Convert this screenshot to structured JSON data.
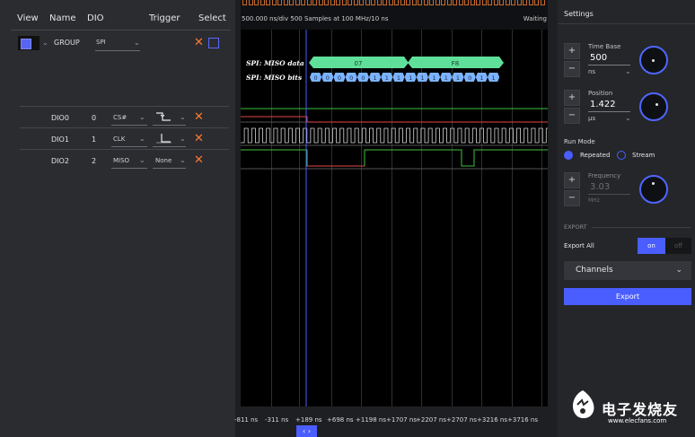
{
  "left": {
    "headers": [
      "View",
      "Name",
      "DIO",
      "Trigger",
      "Select"
    ],
    "group": {
      "name": "GROUP",
      "protocol": "SPI"
    },
    "rows": [
      {
        "name": "DIO0",
        "dio": "0",
        "signal": "CS#"
      },
      {
        "name": "DIO1",
        "dio": "1",
        "signal": "CLK"
      },
      {
        "name": "DIO2",
        "dio": "2",
        "signal": "MISO",
        "trigger_text": "None"
      }
    ],
    "close_glyph": "✕"
  },
  "scope": {
    "status_left": "500.000 ns/div 500 Samples at 100 MHz/10 ns",
    "status_right": "Waiting",
    "labels": {
      "miso_data": "SPI: MISO data",
      "miso_bits": "SPI: MISO bits"
    },
    "bytes": [
      "07",
      "F8"
    ],
    "bits": [
      "0",
      "0",
      "0",
      "0",
      "0",
      "1",
      "1",
      "1",
      "1",
      "1",
      "1",
      "1",
      "1",
      "0",
      "1",
      "1"
    ],
    "axis": [
      "-811 ns",
      "-311 ns",
      "+189 ns",
      "+698 ns",
      "+1198 ns",
      "+1707 ns",
      "+2207 ns",
      "+2707 ns",
      "+3216 ns",
      "+3716 ns"
    ],
    "nav_label": "‹ ›",
    "colors": {
      "decoder": "#5fe09a",
      "bits": "#7bb3ff",
      "clk": "#d8d8d8",
      "cs": "#e04848",
      "miso": "#e04848",
      "green": "#3ec23e"
    }
  },
  "right": {
    "title": "Settings",
    "time_base": {
      "label": "Time Base",
      "value": "500",
      "unit": "ns"
    },
    "position": {
      "label": "Position",
      "value": "1.422",
      "unit": "µs"
    },
    "run_mode": {
      "label": "Run Mode",
      "options": [
        "Repeated",
        "Stream"
      ],
      "selected": "Repeated"
    },
    "frequency": {
      "label": "Frequency",
      "value": "3.03",
      "unit": "MHz"
    },
    "export_section": "EXPORT",
    "export_all": {
      "label": "Export All",
      "on": "on",
      "off": "off",
      "state": "on"
    },
    "channels_label": "Channels",
    "export_button": "Export",
    "plus": "+",
    "minus": "−"
  },
  "watermark": {
    "text": "电子发烧友",
    "url_text": "www.elecfans.com"
  }
}
